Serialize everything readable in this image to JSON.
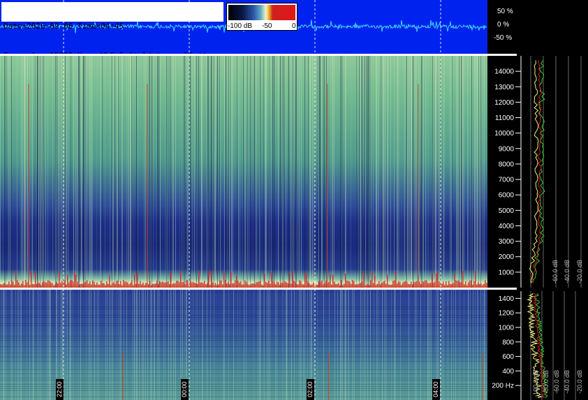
{
  "info": {
    "line1": "Date=2026-09-06 Time=04:45",
    "line2": "Freq= 1...15000 Hz   VLF E-field ©www.vlf.it"
  },
  "scale": {
    "labels": [
      "-100 dB",
      "-50",
      "0"
    ]
  },
  "waveform_axis": {
    "labels": [
      "50 %",
      "0 %",
      "-50 %"
    ]
  },
  "time_axis": {
    "labels": [
      "22:00",
      "00:00",
      "02:00",
      "04:00"
    ]
  },
  "colors": {
    "header_bg": "#0022ee",
    "waveform": "#3fd8ff",
    "spectrum_yellow": "#f0f080",
    "spectrum_green": "#30d030",
    "spectrum_red": "#d02020"
  },
  "chart_data": [
    {
      "type": "heatmap",
      "title": "",
      "xlabel": "",
      "ylabel": "",
      "x": [
        "22:00",
        "00:00",
        "02:00",
        "04:00"
      ],
      "ylim": [
        0,
        15000
      ],
      "yticks": [
        1000,
        2000,
        3000,
        4000,
        5000,
        6000,
        7000,
        8000,
        9000,
        10000,
        11000,
        12000,
        13000,
        14000
      ],
      "color_scale": {
        "min": -100,
        "max": 0,
        "unit": "dB",
        "labels": [
          "-100 dB",
          "-50",
          "0"
        ]
      },
      "grid": true
    },
    {
      "type": "heatmap",
      "title": "",
      "xlabel": "",
      "ylabel": "",
      "x": [
        "22:00",
        "00:00",
        "02:00",
        "04:00"
      ],
      "ylim": [
        0,
        1500
      ],
      "yticks": [
        "200 Hz",
        "400",
        "600",
        "800",
        "1000",
        "1200",
        "1400"
      ],
      "grid": true
    },
    {
      "type": "line",
      "title": "",
      "ylim": [
        0,
        15000
      ],
      "xlabels": [
        "-60.0 dB",
        "-40.0 dB",
        "-20.0 dB"
      ],
      "grid": true
    },
    {
      "type": "line",
      "title": "",
      "ylim": [
        0,
        1500
      ],
      "xlabels": [
        "-100.0 dB",
        "-80.0 dB",
        "-60.0 dB",
        "-40.0 dB",
        "-20.0 dB"
      ],
      "grid": true
    }
  ]
}
